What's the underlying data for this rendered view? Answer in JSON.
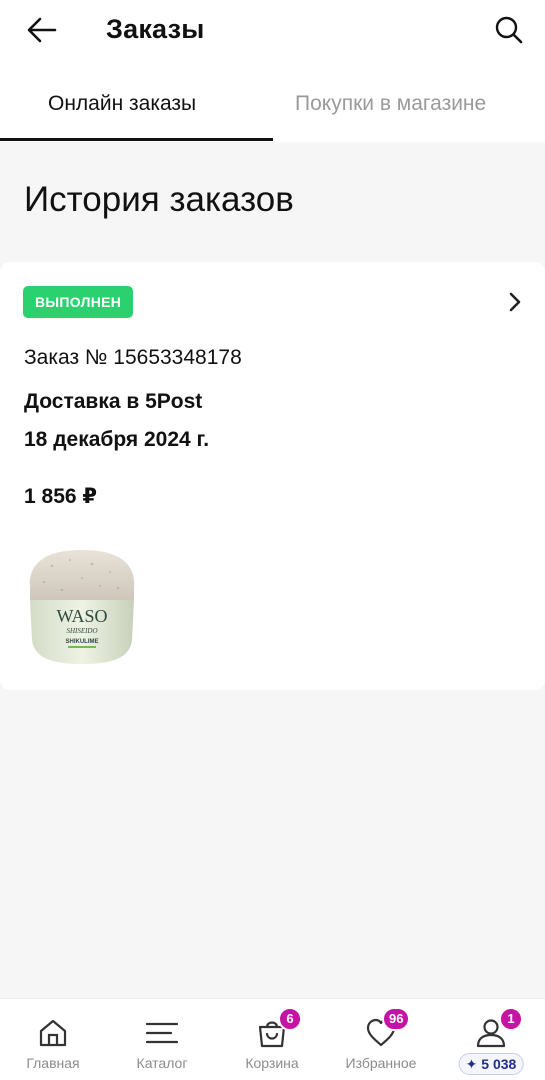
{
  "header": {
    "title": "Заказы",
    "back_icon": "arrow-left-icon",
    "search_icon": "search-icon"
  },
  "tabs": [
    {
      "label": "Онлайн заказы",
      "active": true
    },
    {
      "label": "Покупки в магазине",
      "active": false
    }
  ],
  "section": {
    "title": "История заказов"
  },
  "order": {
    "status": "ВЫПОЛНЕН",
    "status_color": "#2bd16e",
    "number": "Заказ № 15653348178",
    "delivery": "Доставка в 5Post",
    "date": "18 декабря 2024 г.",
    "price": "1 856 ₽",
    "product_brand": "WASO",
    "product_maker": "SHISEIDO",
    "product_line": "SHIKULIME"
  },
  "bottom_nav": {
    "items": [
      {
        "label": "Главная",
        "icon": "home-icon"
      },
      {
        "label": "Каталог",
        "icon": "menu-icon"
      },
      {
        "label": "Корзина",
        "icon": "cart-icon",
        "badge": "6"
      },
      {
        "label": "Избранное",
        "icon": "heart-icon",
        "badge": "96"
      },
      {
        "label": "",
        "icon": "profile-icon",
        "badge": "1",
        "points": "✦ 5 038"
      }
    ],
    "badge_color": "#c414a4"
  }
}
